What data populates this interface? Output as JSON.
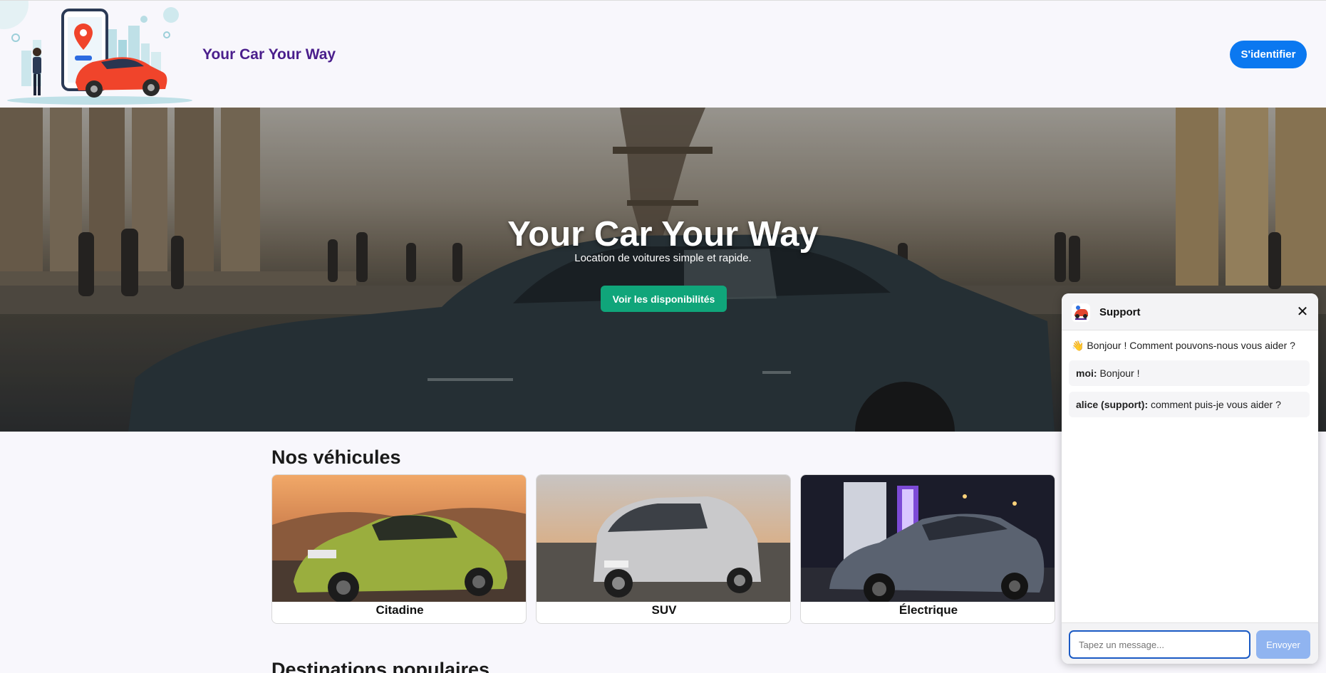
{
  "header": {
    "brand": "Your Car Your Way",
    "login_label": "S'identifier"
  },
  "hero": {
    "title": "Your Car Your Way",
    "subtitle": "Location de voitures simple et rapide.",
    "cta_label": "Voir les disponibilités"
  },
  "vehicles": {
    "title": "Nos véhicules",
    "cards": [
      {
        "label": "Citadine"
      },
      {
        "label": "SUV"
      },
      {
        "label": "Électrique"
      }
    ]
  },
  "destinations": {
    "title": "Destinations populaires"
  },
  "chat": {
    "title": "Support",
    "close_symbol": "✕",
    "welcome": "👋 Bonjour ! Comment pouvons-nous vous aider ?",
    "messages": [
      {
        "author": "moi:",
        "text": "Bonjour !"
      },
      {
        "author": "alice (support):",
        "text": "comment puis-je vous aider ?"
      }
    ],
    "input_placeholder": "Tapez un message...",
    "send_label": "Envoyer"
  },
  "colors": {
    "brand": "#4a1e8c",
    "primary": "#0b78f0",
    "cta": "#10a57a",
    "send_disabled": "#90b4f0"
  }
}
